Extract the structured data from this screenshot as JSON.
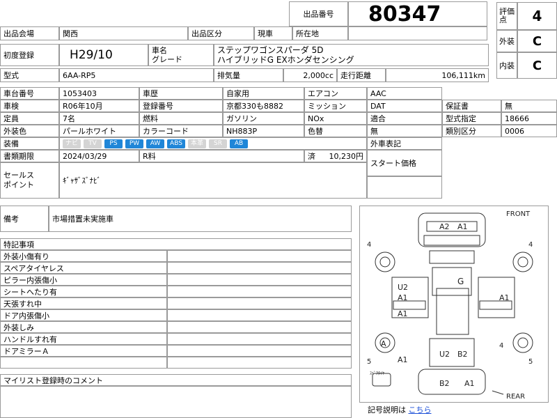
{
  "header": {
    "lot_label": "出品番号",
    "lot_no": "80347",
    "score_label": "評価点",
    "score": "4",
    "ext_label": "外装",
    "ext": "C",
    "int_label": "内装",
    "int": "C",
    "venue_label": "出品会場",
    "venue": "関西",
    "category_label": "出品区分",
    "category": "現車",
    "location_label": "所在地",
    "location": ""
  },
  "car": {
    "reg_label": "初度登録",
    "reg": "H29/10",
    "name_label": "車名\nグレード",
    "name": "ステップワゴンスパーダ 5D\nハイブリッドG EXホンダセンシング",
    "model_label": "型式",
    "model": "6AA-RP5",
    "cc_label": "排気量",
    "cc": "2,000cc",
    "km_label": "走行距離",
    "km": "106,111km"
  },
  "spec": {
    "chassis_label": "車台番号",
    "chassis": "1053403",
    "history_label": "車歴",
    "history": "自家用",
    "ac_label": "エアコン",
    "ac": "AAC",
    "inspection_label": "車検",
    "inspection": "R06年10月",
    "regno_label": "登録番号",
    "regno": "京都330も8882",
    "mission_label": "ミッション",
    "mission": "DAT",
    "warranty_label": "保証書",
    "warranty": "無",
    "capacity_label": "定員",
    "capacity": "7名",
    "fuel_label": "燃料",
    "fuel": "ガソリン",
    "nox_label": "NOx",
    "nox": "適合",
    "typeapp_label": "型式指定",
    "typeapp": "18666",
    "color_label": "外装色",
    "color": "パールホワイト",
    "colorcode_label": "カラーコード",
    "colorcode": "NH883P",
    "colorchange_label": "色替",
    "colorchange": "無",
    "classcat_label": "類別区分",
    "classcat": "0006",
    "equip_label": "装備",
    "equip": [
      "ナビ",
      "TV",
      "PS",
      "PW",
      "AW",
      "ABS",
      "本革",
      "SR",
      "AB"
    ],
    "equip_on": [
      false,
      false,
      true,
      true,
      true,
      true,
      false,
      false,
      true
    ],
    "docdeadline_label": "書類期限",
    "docdeadline": "2024/03/29",
    "recycle_label": "R料",
    "recycle_status": "済",
    "recycle_amount": "10,230円",
    "foreign_label": "外車表記",
    "startprice_label": "スタート価格",
    "sales_label": "セールス\nポイント",
    "sales": "ｷﾞｬｻﾞｽﾞﾅﾋﾞ"
  },
  "remarks": {
    "label": "備考",
    "value": "市場措置未実施車"
  },
  "notes": {
    "label": "特記事項",
    "items": [
      "外装小傷有り",
      "スペアタイヤレス",
      "ピラー内張傷小",
      "シートへたり有",
      "天張すれ中",
      "ドア内張傷小",
      "外装しみ",
      "ハンドルすれ有",
      "ドアミラーＡ",
      ""
    ]
  },
  "mylist": {
    "label": "マイリスト登録時のコメント",
    "value": ""
  },
  "diagram": {
    "front": "FRONT",
    "rear": "REAR",
    "marks": [
      "A2",
      "A1",
      "G",
      "U2",
      "A1",
      "A1",
      "A1",
      "A",
      "A1",
      "U2",
      "B2",
      "B2",
      "A1"
    ],
    "tire_marks": [
      "4",
      "4",
      "4",
      "5",
      "5"
    ],
    "spare_label": "ｽﾍﾟｱﾀｲﾔ",
    "legend_label": "記号説明は",
    "legend_link": "こちら"
  },
  "colors": {
    "accent": "#1f86d8",
    "link": "#1b4fd8",
    "border": "#9a9a9a"
  }
}
